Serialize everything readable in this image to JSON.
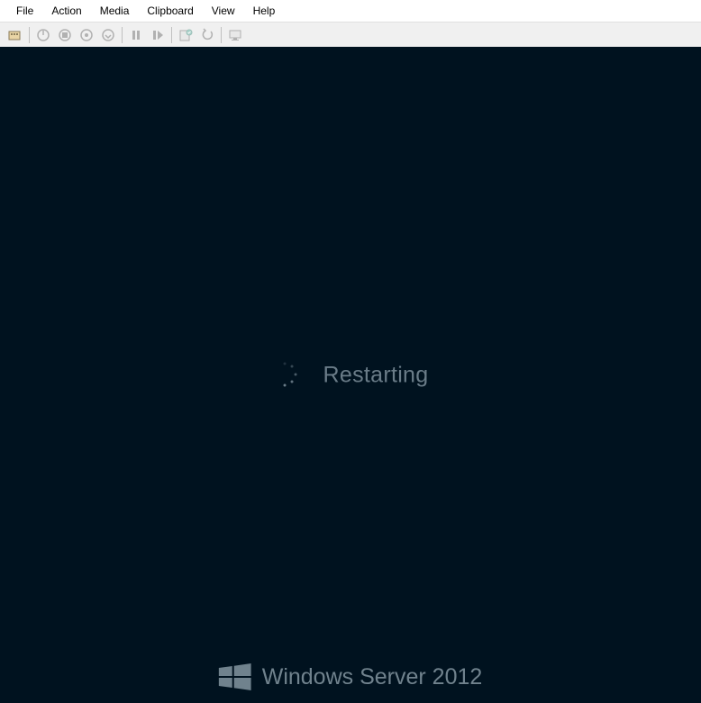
{
  "menubar": {
    "items": [
      {
        "label": "File"
      },
      {
        "label": "Action"
      },
      {
        "label": "Media"
      },
      {
        "label": "Clipboard"
      },
      {
        "label": "View"
      },
      {
        "label": "Help"
      }
    ]
  },
  "toolbar": {
    "ctrlaltdel_icon": "ctrl-alt-del-icon",
    "start_icon": "start-icon",
    "turnoff_icon": "turnoff-icon",
    "shutdown_icon": "shutdown-icon",
    "save_icon": "save-icon",
    "pause_icon": "pause-icon",
    "reset_icon": "reset-icon",
    "checkpoint_icon": "checkpoint-icon",
    "revert_icon": "revert-icon",
    "enhanced_icon": "enhanced-session-icon"
  },
  "vm": {
    "status_text": "Restarting",
    "brand_text": "Windows Server 2012"
  },
  "colors": {
    "vm_bg": "#00121f",
    "vm_fg_dim": "#6a7c88"
  }
}
